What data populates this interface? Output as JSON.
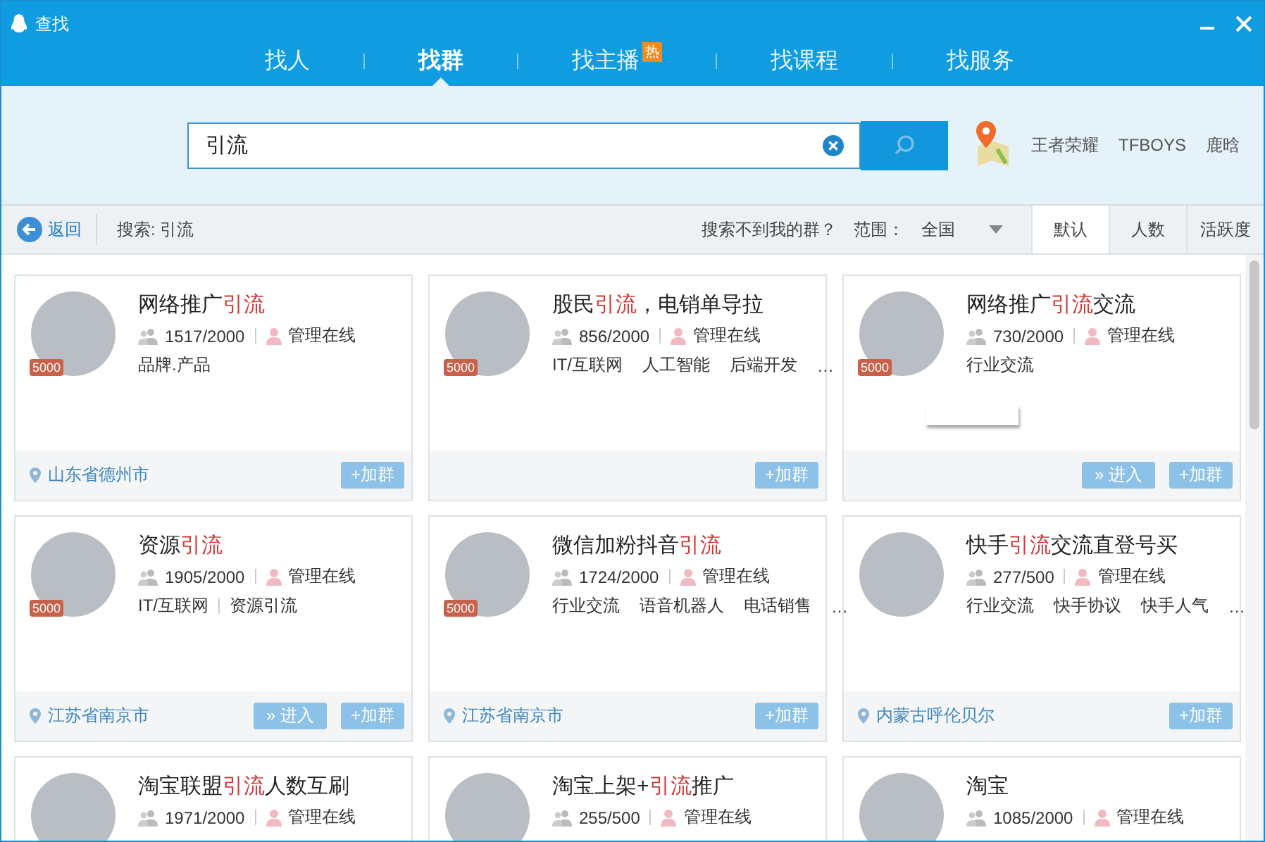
{
  "window": {
    "title": "查找"
  },
  "tabs": [
    {
      "label": "找人",
      "selected": false
    },
    {
      "label": "找群",
      "selected": true
    },
    {
      "label": "找主播",
      "selected": false,
      "badge": "热"
    },
    {
      "label": "找课程",
      "selected": false
    },
    {
      "label": "找服务",
      "selected": false
    }
  ],
  "search": {
    "value": "引流"
  },
  "hot_words": [
    "王者荣耀",
    "TFBOYS",
    "鹿晗"
  ],
  "toolbar": {
    "back": "返回",
    "query": "搜索: 引流",
    "help_link": "搜索不到我的群？",
    "range_label": "范围：",
    "range_value": "全国",
    "sort_tabs": [
      {
        "label": "默认",
        "selected": true
      },
      {
        "label": "人数",
        "selected": false
      },
      {
        "label": "活跃度",
        "selected": false
      }
    ]
  },
  "groups": [
    {
      "title": [
        {
          "text": "网络推广",
          "highlight": false
        },
        {
          "text": "引流",
          "highlight": true
        }
      ],
      "badge": "5000",
      "members": "1517/2000",
      "admin": "管理在线",
      "tags": [
        "品牌.产品"
      ],
      "location": "山东省德州市",
      "buttons": [
        {
          "kind": "join",
          "label": "+加群"
        }
      ]
    },
    {
      "title": [
        {
          "text": "股民",
          "highlight": false
        },
        {
          "text": "引流",
          "highlight": true
        },
        {
          "text": "，电销单导拉",
          "highlight": false
        }
      ],
      "badge": "5000",
      "members": "856/2000",
      "admin": "管理在线",
      "tags": [
        "IT/互联网",
        "人工智能",
        "后端开发",
        "…"
      ],
      "buttons": [
        {
          "kind": "join",
          "label": "+加群"
        }
      ]
    },
    {
      "title": [
        {
          "text": "网络推广",
          "highlight": false
        },
        {
          "text": "引流",
          "highlight": true
        },
        {
          "text": "交流",
          "highlight": false
        }
      ],
      "badge": "5000",
      "members": "730/2000",
      "admin": "管理在线",
      "tags": [
        "行业交流"
      ],
      "popup": true,
      "buttons": [
        {
          "kind": "enter",
          "label": "» 进入"
        },
        {
          "kind": "join",
          "label": "+加群"
        }
      ]
    },
    {
      "title": [
        {
          "text": "资源",
          "highlight": false
        },
        {
          "text": "引流",
          "highlight": true
        }
      ],
      "badge": "5000",
      "members": "1905/2000",
      "admin": "管理在线",
      "tags": [
        "IT/互联网",
        "资源引流"
      ],
      "location": "江苏省南京市",
      "buttons": [
        {
          "kind": "enter",
          "label": "» 进入"
        },
        {
          "kind": "join",
          "label": "+加群"
        }
      ]
    },
    {
      "title": [
        {
          "text": "微信加粉抖音",
          "highlight": false
        },
        {
          "text": "引流",
          "highlight": true
        }
      ],
      "badge": "5000",
      "members": "1724/2000",
      "admin": "管理在线",
      "tags": [
        "行业交流",
        "语音机器人",
        "电话销售",
        "…"
      ],
      "location": "江苏省南京市",
      "buttons": [
        {
          "kind": "join",
          "label": "+加群"
        }
      ]
    },
    {
      "title": [
        {
          "text": "快手",
          "highlight": false
        },
        {
          "text": "引流",
          "highlight": true
        },
        {
          "text": "交流直登号买",
          "highlight": false
        }
      ],
      "members": "277/500",
      "admin": "管理在线",
      "tags": [
        "行业交流",
        "快手协议",
        "快手人气",
        "…"
      ],
      "location": "内蒙古呼伦贝尔",
      "buttons": [
        {
          "kind": "join",
          "label": "+加群"
        }
      ]
    },
    {
      "title": [
        {
          "text": "淘宝联盟",
          "highlight": false
        },
        {
          "text": "引流",
          "highlight": true
        },
        {
          "text": "人数互刷",
          "highlight": false
        }
      ],
      "members": "1971/2000",
      "admin": "管理在线"
    },
    {
      "title": [
        {
          "text": "淘宝上架+",
          "highlight": false
        },
        {
          "text": "引流",
          "highlight": true
        },
        {
          "text": "推广",
          "highlight": false
        }
      ],
      "members": "255/500",
      "admin": "管理在线"
    },
    {
      "title": [
        {
          "text": "淘宝",
          "highlight": false
        }
      ],
      "members": "1085/2000",
      "admin": "管理在线"
    }
  ]
}
